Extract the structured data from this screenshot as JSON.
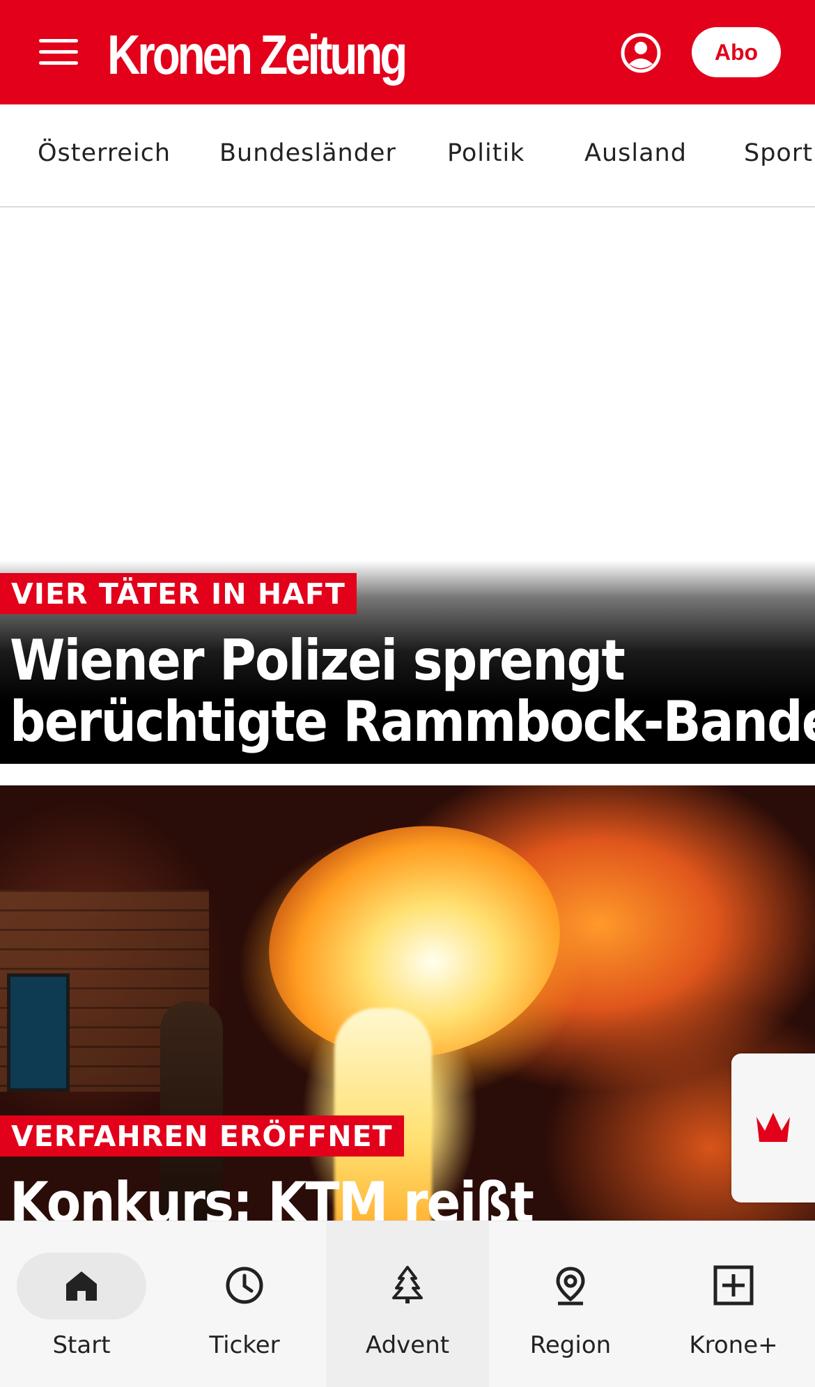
{
  "header": {
    "logo": "Kronen Zeitung",
    "abo_label": "Abo",
    "brand_color": "#e2001a"
  },
  "categories": [
    "Österreich",
    "Bundesländer",
    "Politik",
    "Ausland",
    "Sport"
  ],
  "articles": [
    {
      "kicker": "VIER TÄTER IN HAFT",
      "headline_line1": "Wiener Polizei sprengt",
      "headline_line2": "berüchtigte Rammbock-Bande"
    },
    {
      "kicker": "VERFAHREN ERÖFFNET",
      "headline_line1": "Konkurs: KTM reißt"
    }
  ],
  "bottom_nav": [
    {
      "label": "Start",
      "icon": "home-icon",
      "selected": true
    },
    {
      "label": "Ticker",
      "icon": "clock-icon"
    },
    {
      "label": "Advent",
      "icon": "tree-icon"
    },
    {
      "label": "Region",
      "icon": "location-pin-icon"
    },
    {
      "label": "Krone+",
      "icon": "plus-box-icon"
    }
  ]
}
